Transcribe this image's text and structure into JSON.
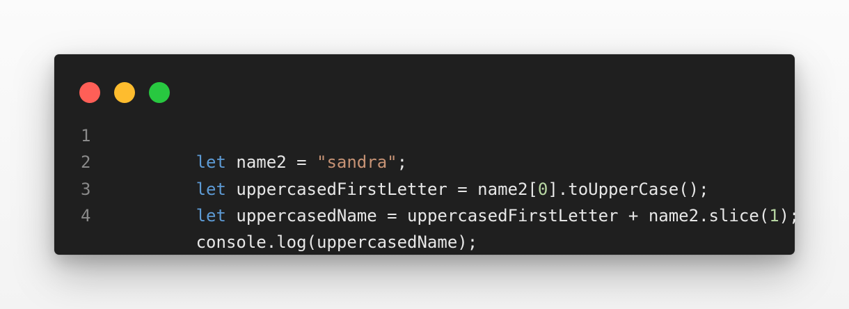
{
  "window": {
    "controls": {
      "close_color": "#ff5f57",
      "minimize_color": "#febc2e",
      "maximize_color": "#28c840"
    }
  },
  "editor": {
    "lines": [
      {
        "number": "1",
        "tokens": [
          {
            "text": "let",
            "type": "kw"
          },
          {
            "text": " name2 = ",
            "type": "plain"
          },
          {
            "text": "\"sandra\"",
            "type": "str"
          },
          {
            "text": ";",
            "type": "plain"
          }
        ]
      },
      {
        "number": "2",
        "tokens": [
          {
            "text": "let",
            "type": "kw"
          },
          {
            "text": " uppercasedFirstLetter = name2[",
            "type": "plain"
          },
          {
            "text": "0",
            "type": "num"
          },
          {
            "text": "].toUpperCase();",
            "type": "plain"
          }
        ]
      },
      {
        "number": "3",
        "tokens": [
          {
            "text": "let",
            "type": "kw"
          },
          {
            "text": " uppercasedName = uppercasedFirstLetter + name2.slice(",
            "type": "plain"
          },
          {
            "text": "1",
            "type": "num"
          },
          {
            "text": ");",
            "type": "plain"
          }
        ]
      },
      {
        "number": "4",
        "tokens": [
          {
            "text": "console.log(uppercasedName);",
            "type": "plain"
          }
        ]
      }
    ]
  }
}
